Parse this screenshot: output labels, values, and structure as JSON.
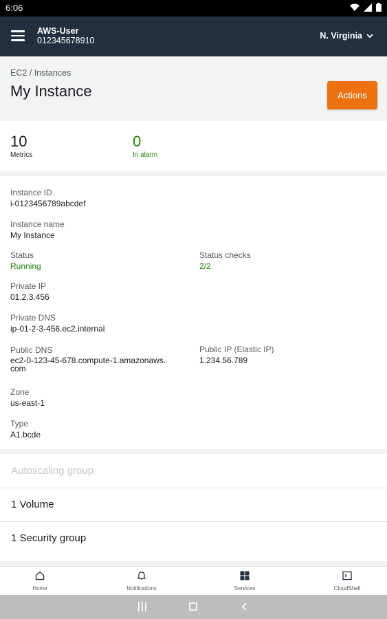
{
  "status_bar": {
    "time": "6:06",
    "icons": [
      "wifi-icon",
      "signal-icon",
      "battery-icon"
    ]
  },
  "app_bar": {
    "account_name": "AWS-User",
    "account_id": "012345678910",
    "region": "N. Virginia"
  },
  "header": {
    "breadcrumb": "EC2 / Instances",
    "title": "My Instance",
    "actions_label": "Actions"
  },
  "metrics": {
    "count": "10",
    "count_label": "Metrics",
    "alarm_count": "0",
    "alarm_label": "In alarm"
  },
  "details": {
    "instance_id_label": "Instance ID",
    "instance_id": "i-0123456789abcdef",
    "instance_name_label": "Instance name",
    "instance_name": "My Instance",
    "status_label": "Status",
    "status": "Running",
    "status_checks_label": "Status checks",
    "status_checks": "2/2",
    "private_ip_label": "Private IP",
    "private_ip": "01.2.3.456",
    "private_dns_label": "Private DNS",
    "private_dns": "ip-01-2-3-456.ec2.internal",
    "public_dns_label": "Public DNS",
    "public_dns_line1": "ec2-0-123-45-678.compute-1.amazonaws.",
    "public_dns_line2": "com",
    "public_ip_label": "Public IP (Elastic IP)",
    "public_ip": "1.234.56.789",
    "zone_label": "Zone",
    "zone": "us-east-1",
    "type_label": "Type",
    "type": "A1.bcde"
  },
  "list": {
    "autoscaling": "Autoscaling group",
    "volume": "1 Volume",
    "security_group": "1 Security group"
  },
  "bottom_nav": {
    "home": "Home",
    "notifications": "Notifications",
    "services": "Services",
    "cloudshell": "CloudShell"
  },
  "colors": {
    "app_bar": "#232f3e",
    "accent": "#ec7211",
    "success": "#1d8102"
  }
}
